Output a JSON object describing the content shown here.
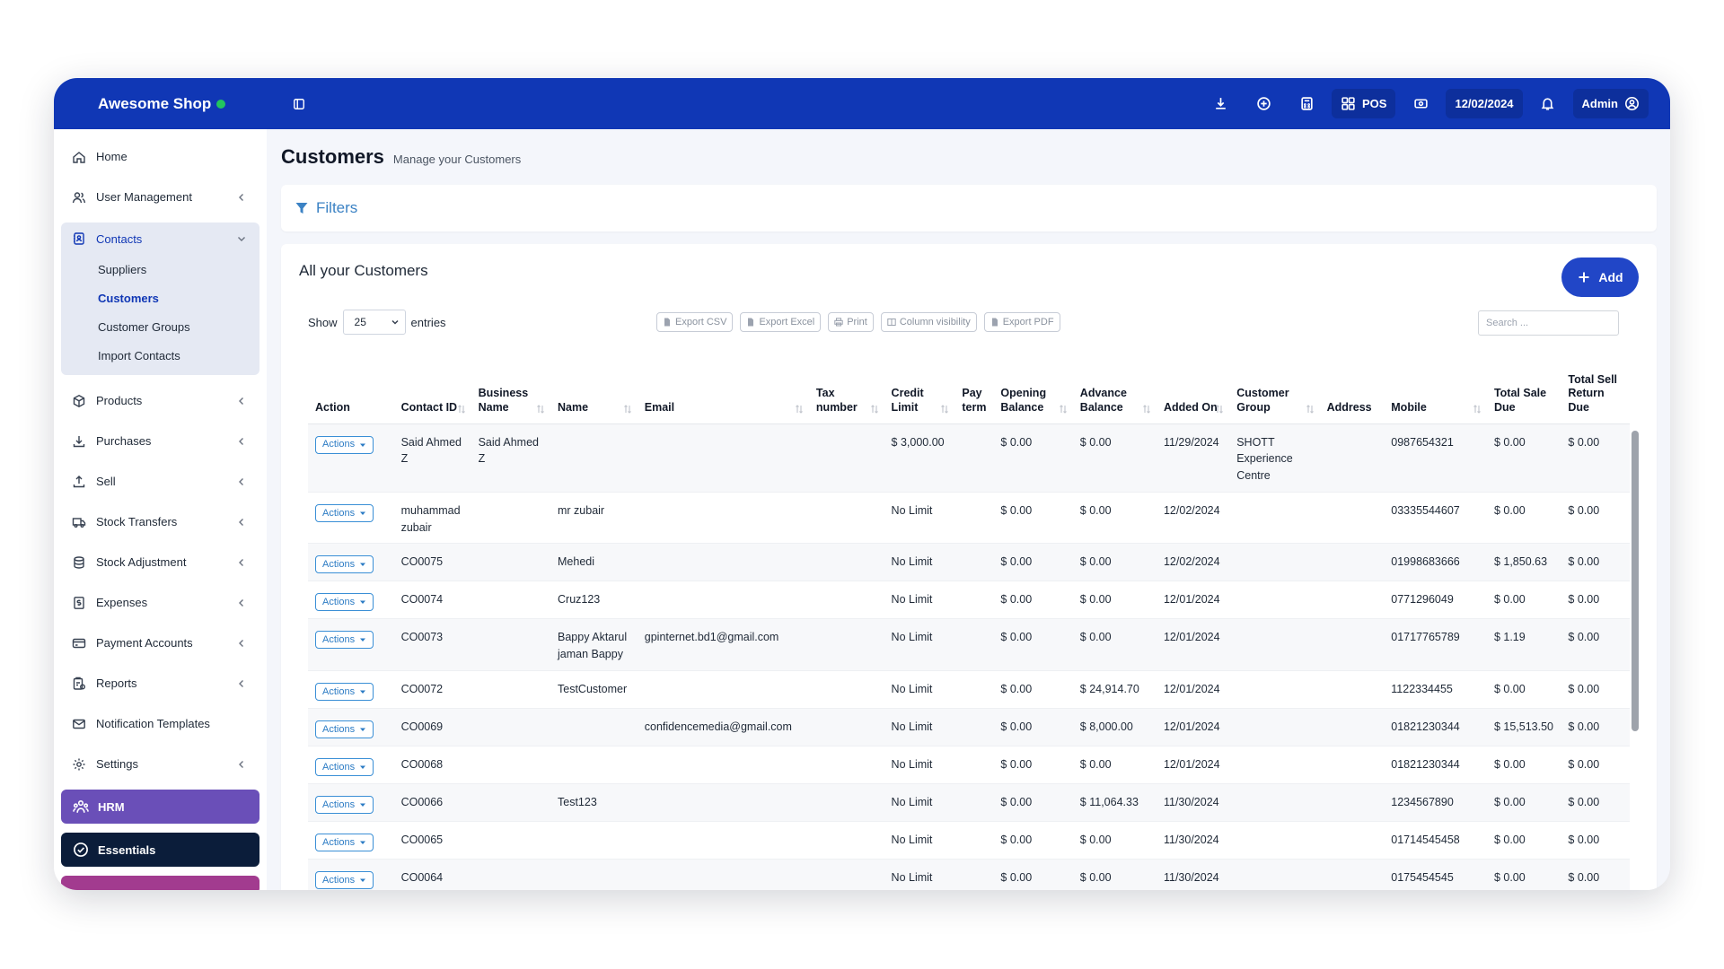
{
  "app": {
    "brand": "Awesome Shop",
    "topbar": {
      "pos_label": "POS",
      "date": "12/02/2024",
      "user": "Admin"
    }
  },
  "sidebar": {
    "home": "Home",
    "user_management": "User Management",
    "contacts": "Contacts",
    "contacts_sub": [
      "Suppliers",
      "Customers",
      "Customer Groups",
      "Import Contacts"
    ],
    "products": "Products",
    "purchases": "Purchases",
    "sell": "Sell",
    "stock_transfers": "Stock Transfers",
    "stock_adjustment": "Stock Adjustment",
    "expenses": "Expenses",
    "payment_accounts": "Payment Accounts",
    "reports": "Reports",
    "notification_templates": "Notification Templates",
    "settings": "Settings",
    "hrm": "HRM",
    "essentials": "Essentials"
  },
  "page": {
    "title": "Customers",
    "subtitle": "Manage your Customers",
    "filters": "Filters",
    "card_title": "All your Customers",
    "add_label": "Add",
    "show_label": "Show",
    "entries_value": "25",
    "entries_label": "entries",
    "exports": [
      "Export CSV",
      "Export Excel",
      "Print",
      "Column visibility",
      "Export PDF"
    ],
    "search_placeholder": "Search ..."
  },
  "table": {
    "headers": [
      "Action",
      "Contact ID",
      "Business Name",
      "Name",
      "Email",
      "Tax number",
      "Credit Limit",
      "Pay term",
      "Opening Balance",
      "Advance Balance",
      "Added On",
      "Customer Group",
      "Address",
      "Mobile",
      "Total Sale Due",
      "Total Sell Return Due"
    ],
    "action_label": "Actions",
    "rows": [
      [
        "Said Ahmed Z",
        "Said Ahmed Z",
        "",
        "",
        "",
        "$ 3,000.00",
        "",
        "$ 0.00",
        "$ 0.00",
        "11/29/2024",
        "SHOTT Experience Centre",
        "",
        "0987654321",
        "$ 0.00",
        "$ 0.00"
      ],
      [
        "muhammad zubair",
        "",
        "mr zubair",
        "",
        "",
        "No Limit",
        "",
        "$ 0.00",
        "$ 0.00",
        "12/02/2024",
        "",
        "",
        "03335544607",
        "$ 0.00",
        "$ 0.00"
      ],
      [
        "CO0075",
        "",
        "Mehedi",
        "",
        "",
        "No Limit",
        "",
        "$ 0.00",
        "$ 0.00",
        "12/02/2024",
        "",
        "",
        "01998683666",
        "$ 1,850.63",
        "$ 0.00"
      ],
      [
        "CO0074",
        "",
        "Cruz123",
        "",
        "",
        "No Limit",
        "",
        "$ 0.00",
        "$ 0.00",
        "12/01/2024",
        "",
        "",
        "0771296049",
        "$ 0.00",
        "$ 0.00"
      ],
      [
        "CO0073",
        "",
        "Bappy Aktarul jaman Bappy",
        "gpinternet.bd1@gmail.com",
        "",
        "No Limit",
        "",
        "$ 0.00",
        "$ 0.00",
        "12/01/2024",
        "",
        "",
        "01717765789",
        "$ 1.19",
        "$ 0.00"
      ],
      [
        "CO0072",
        "",
        "TestCustomer",
        "",
        "",
        "No Limit",
        "",
        "$ 0.00",
        "$ 24,914.70",
        "12/01/2024",
        "",
        "",
        "1122334455",
        "$ 0.00",
        "$ 0.00"
      ],
      [
        "CO0069",
        "",
        "",
        "confidencemedia@gmail.com",
        "",
        "No Limit",
        "",
        "$ 0.00",
        "$ 8,000.00",
        "12/01/2024",
        "",
        "",
        "01821230344",
        "$ 15,513.50",
        "$ 0.00"
      ],
      [
        "CO0068",
        "",
        "",
        "",
        "",
        "No Limit",
        "",
        "$ 0.00",
        "$ 0.00",
        "12/01/2024",
        "",
        "",
        "01821230344",
        "$ 0.00",
        "$ 0.00"
      ],
      [
        "CO0066",
        "",
        "Test123",
        "",
        "",
        "No Limit",
        "",
        "$ 0.00",
        "$ 11,064.33",
        "11/30/2024",
        "",
        "",
        "1234567890",
        "$ 0.00",
        "$ 0.00"
      ],
      [
        "CO0065",
        "",
        "",
        "",
        "",
        "No Limit",
        "",
        "$ 0.00",
        "$ 0.00",
        "11/30/2024",
        "",
        "",
        "01714545458",
        "$ 0.00",
        "$ 0.00"
      ],
      [
        "CO0064",
        "",
        "",
        "",
        "",
        "No Limit",
        "",
        "$ 0.00",
        "$ 0.00",
        "11/30/2024",
        "",
        "",
        "0175454545",
        "$ 0.00",
        "$ 0.00"
      ]
    ]
  },
  "icons": {
    "download": "download-icon",
    "plus_circle": "plus-circle-icon",
    "calculator": "calculator-icon",
    "grid": "grid-icon",
    "cash": "cash-icon",
    "bell": "bell-icon",
    "user_circle": "user-circle-icon"
  },
  "colors": {
    "topbar": "#1037b5",
    "accent": "#2146c7",
    "hrm": "#6a4fb8",
    "essentials": "#0b1d3a",
    "status_online": "#22c55e"
  }
}
